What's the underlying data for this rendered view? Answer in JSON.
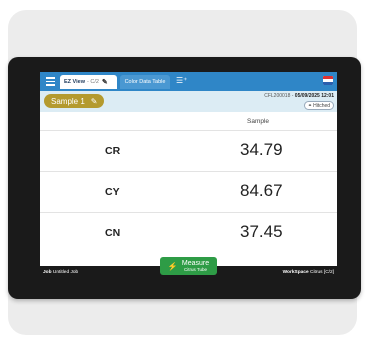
{
  "tabs": {
    "ez_view_label": "EZ View",
    "ez_view_sub": "- C/2",
    "color_data_table_label": "Color Data Table"
  },
  "header": {
    "sample_label": "Sample 1",
    "id_prefix": "CFL200018 - ",
    "datetime": "05/09/2025 12:01",
    "hitched_label": "Hitched"
  },
  "table": {
    "column_header": "Sample",
    "rows": [
      {
        "label": "CR",
        "value": "34.79"
      },
      {
        "label": "CY",
        "value": "84.67"
      },
      {
        "label": "CN",
        "value": "37.45"
      }
    ]
  },
  "footer": {
    "job_label": "Job",
    "job_value": "Untitled Job",
    "workspace_label": "WorkSpace",
    "workspace_value": "Citrus [C/2]"
  },
  "measure_button": {
    "label": "Measure",
    "sub_label": "Citrus Tube"
  },
  "colors": {
    "topbar": "#2f86c7",
    "sample_pill": "#b49a2e",
    "measure_button": "#2e9c46",
    "device_bezel": "#1a1a1a"
  },
  "icons": [
    "menu-icon",
    "pencil-icon",
    "add-tab-icon",
    "flag-icon",
    "link-icon",
    "bolt-icon"
  ]
}
